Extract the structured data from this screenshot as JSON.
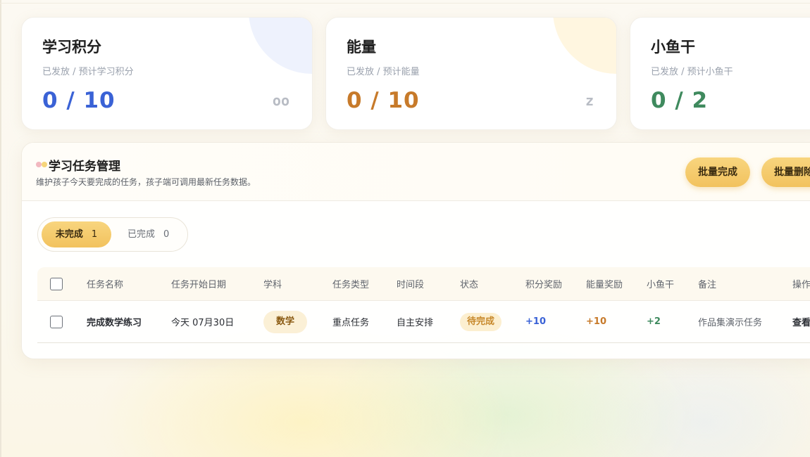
{
  "stats": [
    {
      "title": "学习积分",
      "subtitle": "已发放 / 预计学习积分",
      "value": "0 / 10",
      "icon": "oo",
      "color": "#3a62d6",
      "deco": "#eef2fd"
    },
    {
      "title": "能量",
      "subtitle": "已发放 / 预计能量",
      "value": "0 / 10",
      "icon": "z",
      "color": "#c77a2a",
      "deco": "#fff6e0"
    },
    {
      "title": "小鱼干",
      "subtitle": "已发放 / 预计小鱼干",
      "value": "0 / 2",
      "icon": "",
      "color": "#3f8a5e",
      "deco": "#eef7f0"
    }
  ],
  "panel": {
    "title": "学习任务管理",
    "description": "维护孩子今天要完成的任务，孩子端可调用最新任务数据。",
    "buttons": {
      "batch_complete": "批量完成",
      "batch_delete": "批量删除"
    }
  },
  "tabs": [
    {
      "label": "未完成",
      "count": "1",
      "active": true
    },
    {
      "label": "已完成",
      "count": "0",
      "active": false
    }
  ],
  "table": {
    "headers": [
      "任务名称",
      "任务开始日期",
      "学科",
      "任务类型",
      "时间段",
      "状态",
      "积分奖励",
      "能量奖励",
      "小鱼干",
      "备注",
      "操作"
    ],
    "rows": [
      {
        "name": "完成数学练习",
        "date": "今天 07月30日",
        "subject": "数学",
        "type": "重点任务",
        "time_slot": "自主安排",
        "status": "待完成",
        "points": "+10",
        "energy": "+10",
        "fish": "+2",
        "note": "作品集演示任务",
        "action": "查看"
      }
    ]
  },
  "colors": {
    "points": "#3a62d6",
    "energy": "#c77a2a",
    "fish": "#3f8a5e",
    "accent": "#f2c25e"
  }
}
